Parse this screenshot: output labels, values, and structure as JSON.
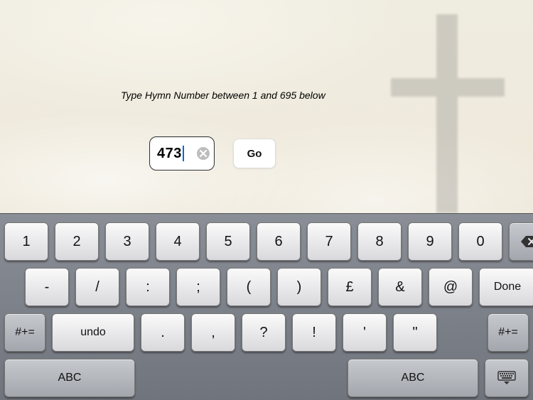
{
  "prompt": "Type Hymn Number between 1 and 695 below",
  "input": {
    "value": "473"
  },
  "go_label": "Go",
  "keyboard": {
    "row1": [
      "1",
      "2",
      "3",
      "4",
      "5",
      "6",
      "7",
      "8",
      "9",
      "0"
    ],
    "row2": [
      "-",
      "/",
      ":",
      ";",
      "(",
      ")",
      "£",
      "&",
      "@"
    ],
    "done_label": "Done",
    "row3_mode": "#+=",
    "undo_label": "undo",
    "row3_punct": [
      ".",
      ",",
      "?",
      "!",
      "'",
      "\""
    ],
    "row4_abc": "ABC"
  }
}
